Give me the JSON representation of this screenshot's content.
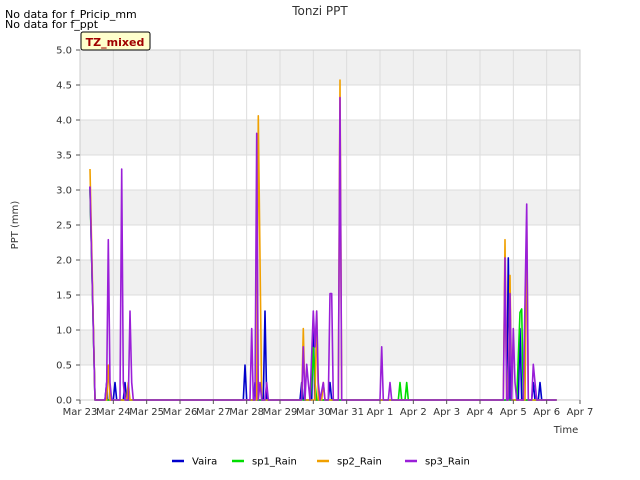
{
  "notes": [
    "No data for f_Pricip_mm",
    "No data for f_ppt"
  ],
  "badge": "TZ_mixed",
  "chart_data": {
    "type": "line",
    "title": "Tonzi PPT",
    "xlabel": "Time",
    "ylabel": "PPT (mm)",
    "ylim": [
      0,
      5.0
    ],
    "xlim": [
      0,
      15
    ],
    "x_unit": "days from Mar 23",
    "yticks": [
      "0.0",
      "0.5",
      "1.0",
      "1.5",
      "2.0",
      "2.5",
      "3.0",
      "3.5",
      "4.0",
      "4.5",
      "5.0"
    ],
    "xticks": [
      "Mar 23",
      "Mar 24",
      "Mar 25",
      "Mar 26",
      "Mar 27",
      "Mar 28",
      "Mar 29",
      "Mar 30",
      "Mar 31",
      "Apr 1",
      "Apr 2",
      "Apr 3",
      "Apr 4",
      "Apr 5",
      "Apr 6",
      "Apr 7"
    ],
    "grid": true,
    "legend_position": "bottom",
    "series": [
      {
        "name": "Vaira",
        "color": "#0000cc",
        "points": [
          [
            0.3,
            3.05
          ],
          [
            0.45,
            0
          ],
          [
            0.75,
            0
          ],
          [
            0.8,
            0.25
          ],
          [
            0.83,
            0
          ],
          [
            1.0,
            0
          ],
          [
            1.05,
            0.25
          ],
          [
            1.1,
            0
          ],
          [
            1.3,
            0
          ],
          [
            1.35,
            0.25
          ],
          [
            1.4,
            0
          ],
          [
            4.9,
            0
          ],
          [
            4.95,
            0.5
          ],
          [
            5.0,
            0
          ],
          [
            5.2,
            0
          ],
          [
            5.25,
            0.25
          ],
          [
            5.3,
            0
          ],
          [
            5.5,
            0
          ],
          [
            5.55,
            1.27
          ],
          [
            5.6,
            0
          ],
          [
            6.6,
            0
          ],
          [
            6.65,
            0.25
          ],
          [
            6.7,
            0
          ],
          [
            6.95,
            0
          ],
          [
            7.0,
            1.02
          ],
          [
            7.05,
            0
          ],
          [
            7.45,
            0
          ],
          [
            7.5,
            0.25
          ],
          [
            7.55,
            0
          ],
          [
            12.8,
            0
          ],
          [
            12.85,
            2.03
          ],
          [
            12.9,
            0
          ],
          [
            13.15,
            0
          ],
          [
            13.2,
            1.02
          ],
          [
            13.25,
            0
          ],
          [
            13.55,
            0
          ],
          [
            13.6,
            0.25
          ],
          [
            13.65,
            0
          ],
          [
            13.75,
            0
          ],
          [
            13.8,
            0.25
          ],
          [
            13.85,
            0
          ],
          [
            14.3,
            0
          ]
        ]
      },
      {
        "name": "sp1_Rain",
        "color": "#00dd00",
        "points": [
          [
            0.3,
            3.0
          ],
          [
            0.45,
            0
          ],
          [
            6.9,
            0
          ],
          [
            6.95,
            0.25
          ],
          [
            7.0,
            0.75
          ],
          [
            7.05,
            0.25
          ],
          [
            7.1,
            0
          ],
          [
            9.55,
            0
          ],
          [
            9.6,
            0.25
          ],
          [
            9.65,
            0
          ],
          [
            9.75,
            0
          ],
          [
            9.8,
            0.25
          ],
          [
            9.85,
            0
          ],
          [
            13.1,
            0
          ],
          [
            13.2,
            1.25
          ],
          [
            13.25,
            1.3
          ],
          [
            13.3,
            0
          ],
          [
            14.3,
            0
          ]
        ]
      },
      {
        "name": "sp2_Rain",
        "color": "#f0a000",
        "points": [
          [
            0.3,
            3.3
          ],
          [
            0.45,
            0
          ],
          [
            0.8,
            0
          ],
          [
            0.85,
            0.5
          ],
          [
            0.9,
            0
          ],
          [
            1.4,
            0
          ],
          [
            1.45,
            0.25
          ],
          [
            1.5,
            0
          ],
          [
            5.3,
            0
          ],
          [
            5.35,
            4.06
          ],
          [
            5.45,
            0
          ],
          [
            6.65,
            0
          ],
          [
            6.7,
            1.02
          ],
          [
            6.75,
            0
          ],
          [
            7.05,
            0
          ],
          [
            7.1,
            1.27
          ],
          [
            7.15,
            0
          ],
          [
            7.25,
            0
          ],
          [
            7.3,
            0.25
          ],
          [
            7.35,
            0
          ],
          [
            7.75,
            0
          ],
          [
            7.8,
            4.57
          ],
          [
            7.85,
            0
          ],
          [
            12.7,
            0
          ],
          [
            12.75,
            2.29
          ],
          [
            12.8,
            0
          ],
          [
            12.85,
            0
          ],
          [
            12.9,
            1.78
          ],
          [
            12.95,
            0
          ],
          [
            13.35,
            0
          ],
          [
            13.4,
            2.54
          ],
          [
            13.45,
            0
          ],
          [
            14.3,
            0
          ]
        ]
      },
      {
        "name": "sp3_Rain",
        "color": "#9a1fd8",
        "points": [
          [
            0.3,
            3.05
          ],
          [
            0.45,
            0
          ],
          [
            0.75,
            0
          ],
          [
            0.8,
            0.25
          ],
          [
            0.85,
            2.29
          ],
          [
            0.9,
            0.25
          ],
          [
            0.95,
            0
          ],
          [
            1.2,
            0
          ],
          [
            1.25,
            3.3
          ],
          [
            1.3,
            0.25
          ],
          [
            1.35,
            0
          ],
          [
            1.45,
            0
          ],
          [
            1.5,
            1.27
          ],
          [
            1.55,
            0.25
          ],
          [
            1.6,
            0
          ],
          [
            5.1,
            0
          ],
          [
            5.15,
            1.02
          ],
          [
            5.2,
            0
          ],
          [
            5.25,
            0
          ],
          [
            5.3,
            3.81
          ],
          [
            5.35,
            0
          ],
          [
            5.4,
            0.25
          ],
          [
            5.45,
            0
          ],
          [
            5.55,
            0
          ],
          [
            5.6,
            0.25
          ],
          [
            5.65,
            0
          ],
          [
            6.65,
            0
          ],
          [
            6.7,
            0.76
          ],
          [
            6.75,
            0
          ],
          [
            6.8,
            0.51
          ],
          [
            6.85,
            0.25
          ],
          [
            6.9,
            0
          ],
          [
            7.0,
            1.27
          ],
          [
            7.05,
            0.76
          ],
          [
            7.1,
            1.27
          ],
          [
            7.15,
            0.25
          ],
          [
            7.2,
            0
          ],
          [
            7.3,
            0.25
          ],
          [
            7.35,
            0
          ],
          [
            7.45,
            0
          ],
          [
            7.5,
            1.52
          ],
          [
            7.55,
            1.52
          ],
          [
            7.6,
            0
          ],
          [
            7.75,
            0
          ],
          [
            7.8,
            4.32
          ],
          [
            7.85,
            0
          ],
          [
            9.0,
            0
          ],
          [
            9.05,
            0.76
          ],
          [
            9.1,
            0
          ],
          [
            9.25,
            0
          ],
          [
            9.3,
            0.25
          ],
          [
            9.35,
            0
          ],
          [
            12.7,
            0
          ],
          [
            12.75,
            2.03
          ],
          [
            12.8,
            0
          ],
          [
            12.85,
            0
          ],
          [
            12.9,
            1.52
          ],
          [
            12.95,
            0
          ],
          [
            13.0,
            1.02
          ],
          [
            13.05,
            0.25
          ],
          [
            13.1,
            0
          ],
          [
            13.3,
            0
          ],
          [
            13.4,
            2.8
          ],
          [
            13.45,
            0
          ],
          [
            13.55,
            0
          ],
          [
            13.6,
            0.51
          ],
          [
            13.65,
            0.25
          ],
          [
            13.7,
            0
          ],
          [
            14.3,
            0
          ]
        ]
      }
    ]
  }
}
